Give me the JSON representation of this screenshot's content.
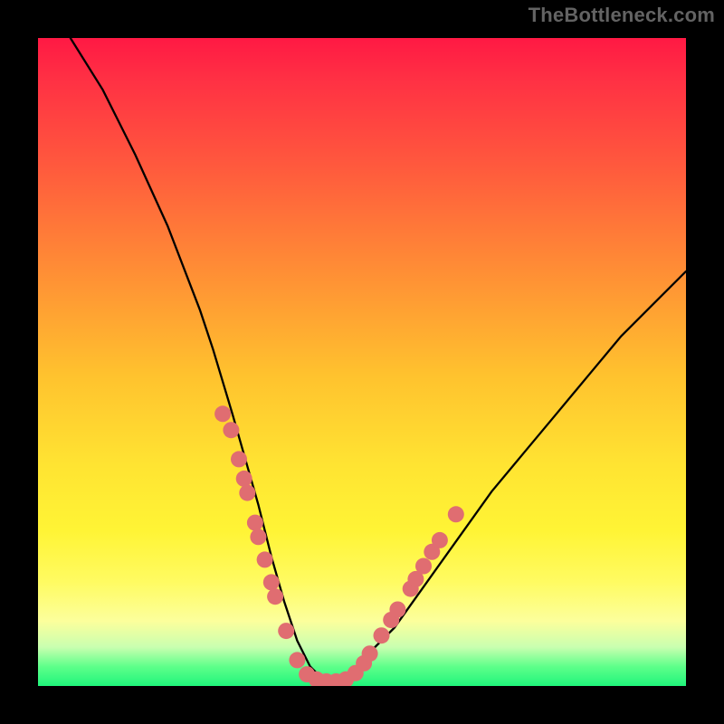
{
  "watermark": "TheBottleneck.com",
  "chart_data": {
    "type": "line",
    "title": "",
    "xlabel": "",
    "ylabel": "",
    "xlim": [
      0,
      100
    ],
    "ylim": [
      0,
      100
    ],
    "grid": false,
    "series": [
      {
        "name": "bottleneck-curve",
        "x": [
          5,
          10,
          15,
          20,
          25,
          27,
          30,
          32,
          34,
          36,
          38,
          40,
          42,
          44,
          46,
          48,
          50,
          55,
          60,
          65,
          70,
          75,
          80,
          85,
          90,
          95,
          100
        ],
        "values": [
          100,
          92,
          82,
          71,
          58,
          52,
          42,
          35,
          28,
          20,
          13,
          7,
          3,
          1,
          0,
          1,
          4,
          9,
          16,
          23,
          30,
          36,
          42,
          48,
          54,
          59,
          64
        ]
      }
    ],
    "markers": [
      {
        "x_pct": 28.5,
        "y_pct_from_top": 58.0
      },
      {
        "x_pct": 29.8,
        "y_pct_from_top": 60.5
      },
      {
        "x_pct": 31.0,
        "y_pct_from_top": 65.0
      },
      {
        "x_pct": 31.8,
        "y_pct_from_top": 68.0
      },
      {
        "x_pct": 32.3,
        "y_pct_from_top": 70.2
      },
      {
        "x_pct": 33.5,
        "y_pct_from_top": 74.8
      },
      {
        "x_pct": 34.0,
        "y_pct_from_top": 77.0
      },
      {
        "x_pct": 35.0,
        "y_pct_from_top": 80.5
      },
      {
        "x_pct": 36.0,
        "y_pct_from_top": 84.0
      },
      {
        "x_pct": 36.6,
        "y_pct_from_top": 86.2
      },
      {
        "x_pct": 38.3,
        "y_pct_from_top": 91.5
      },
      {
        "x_pct": 40.0,
        "y_pct_from_top": 96.0
      },
      {
        "x_pct": 41.5,
        "y_pct_from_top": 98.2
      },
      {
        "x_pct": 43.0,
        "y_pct_from_top": 99.0
      },
      {
        "x_pct": 44.5,
        "y_pct_from_top": 99.3
      },
      {
        "x_pct": 46.0,
        "y_pct_from_top": 99.3
      },
      {
        "x_pct": 47.5,
        "y_pct_from_top": 99.0
      },
      {
        "x_pct": 49.0,
        "y_pct_from_top": 98.0
      },
      {
        "x_pct": 50.3,
        "y_pct_from_top": 96.5
      },
      {
        "x_pct": 51.2,
        "y_pct_from_top": 95.0
      },
      {
        "x_pct": 53.0,
        "y_pct_from_top": 92.2
      },
      {
        "x_pct": 54.5,
        "y_pct_from_top": 89.8
      },
      {
        "x_pct": 55.5,
        "y_pct_from_top": 88.2
      },
      {
        "x_pct": 57.5,
        "y_pct_from_top": 85.0
      },
      {
        "x_pct": 58.3,
        "y_pct_from_top": 83.5
      },
      {
        "x_pct": 59.5,
        "y_pct_from_top": 81.5
      },
      {
        "x_pct": 60.8,
        "y_pct_from_top": 79.3
      },
      {
        "x_pct": 62.0,
        "y_pct_from_top": 77.5
      },
      {
        "x_pct": 64.5,
        "y_pct_from_top": 73.5
      }
    ],
    "gradient_colors": {
      "top": "#ff1944",
      "mid_upper": "#ff8e35",
      "mid": "#ffe432",
      "mid_lower": "#fcff9c",
      "bottom": "#20f57b"
    },
    "marker_color": "#e06d71",
    "curve_color": "#000000"
  }
}
